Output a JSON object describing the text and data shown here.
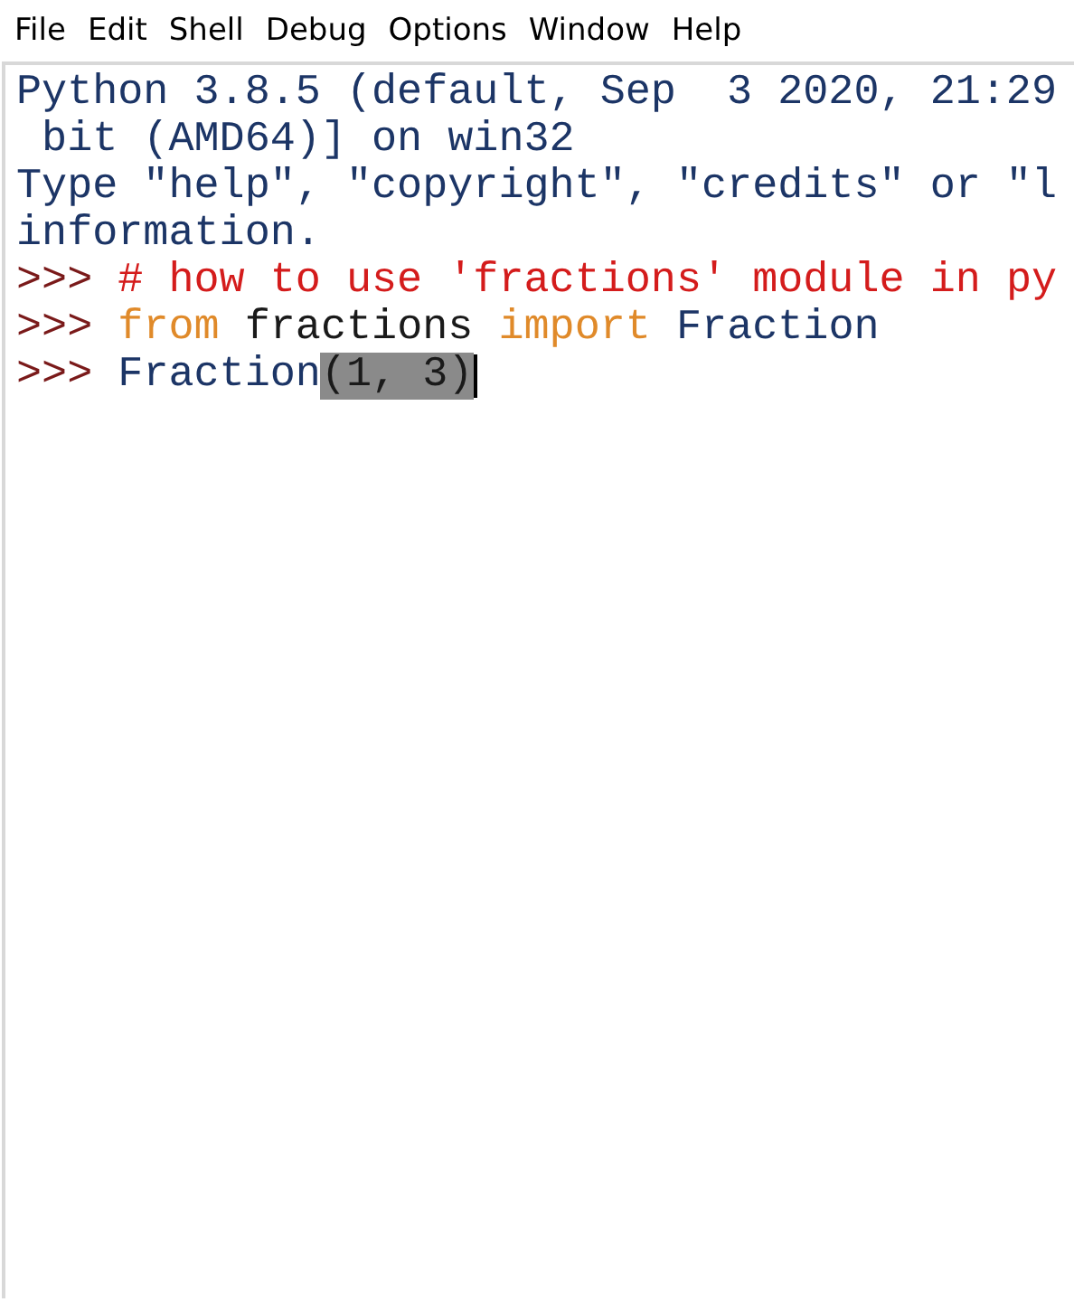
{
  "menu": [
    {
      "label": "File"
    },
    {
      "label": "Edit"
    },
    {
      "label": "Shell"
    },
    {
      "label": "Debug"
    },
    {
      "label": "Options"
    },
    {
      "label": "Window"
    },
    {
      "label": "Help"
    }
  ],
  "shell_lines": [
    {
      "segments": [
        {
          "kind": "output",
          "text": "Python 3.8.5 (default, Sep  3 2020, 21:29",
          "selected": false
        }
      ]
    },
    {
      "segments": [
        {
          "kind": "output",
          "text": " bit (AMD64)] on win32",
          "selected": false
        }
      ]
    },
    {
      "segments": [
        {
          "kind": "output",
          "text": "Type \"help\", \"copyright\", \"credits\" or \"l",
          "selected": false
        }
      ]
    },
    {
      "segments": [
        {
          "kind": "output",
          "text": "information.",
          "selected": false
        }
      ]
    },
    {
      "segments": [
        {
          "kind": "prompt",
          "text": ">>> ",
          "selected": false
        },
        {
          "kind": "comment",
          "text": "# how to use 'fractions' module in py",
          "selected": false
        }
      ]
    },
    {
      "segments": [
        {
          "kind": "prompt",
          "text": ">>> ",
          "selected": false
        },
        {
          "kind": "keyword",
          "text": "from",
          "selected": false
        },
        {
          "kind": "plain",
          "text": " fractions ",
          "selected": false
        },
        {
          "kind": "keyword",
          "text": "import",
          "selected": false
        },
        {
          "kind": "name",
          "text": " Fraction",
          "selected": false
        }
      ]
    },
    {
      "segments": [
        {
          "kind": "prompt",
          "text": ">>> ",
          "selected": false
        },
        {
          "kind": "name",
          "text": "Fraction",
          "selected": false
        },
        {
          "kind": "plain",
          "text": "(1, 3)",
          "selected": true
        }
      ],
      "cursor": true
    }
  ]
}
